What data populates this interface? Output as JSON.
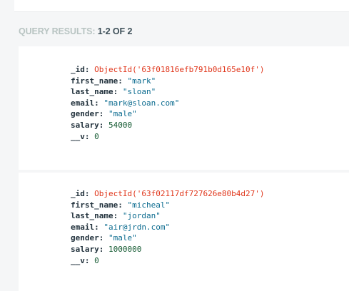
{
  "header": {
    "label": "QUERY RESULTS:",
    "count": "1-2 OF 2"
  },
  "documents": [
    {
      "_id_value": "ObjectId('63f01816efb791b0d165e10f')",
      "fields": [
        {
          "key": "first_name:",
          "value": "\"mark\""
        },
        {
          "key": "last_name:",
          "value": "\"sloan\""
        },
        {
          "key": "email:",
          "value": "\"mark@sloan.com\""
        },
        {
          "key": "gender:",
          "value": "\"male\""
        },
        {
          "key": "salary:",
          "value": "54000"
        },
        {
          "key": "__v:",
          "value": "0"
        }
      ]
    },
    {
      "_id_value": "ObjectId('63f02117df727626e80b4d27')",
      "fields": [
        {
          "key": "first_name:",
          "value": "\"micheal\""
        },
        {
          "key": "last_name:",
          "value": "\"jordan\""
        },
        {
          "key": "email:",
          "value": "\"air@jrdn.com\""
        },
        {
          "key": "gender:",
          "value": "\"male\""
        },
        {
          "key": "salary:",
          "value": "1000000"
        },
        {
          "key": "__v:",
          "value": "0"
        }
      ]
    }
  ],
  "id_key": "_id:",
  "colors": {
    "key": "#21313c",
    "string": "#0b6b8f",
    "number": "#145a32",
    "objectid": "#e0361b",
    "label": "#b8c4c2"
  }
}
